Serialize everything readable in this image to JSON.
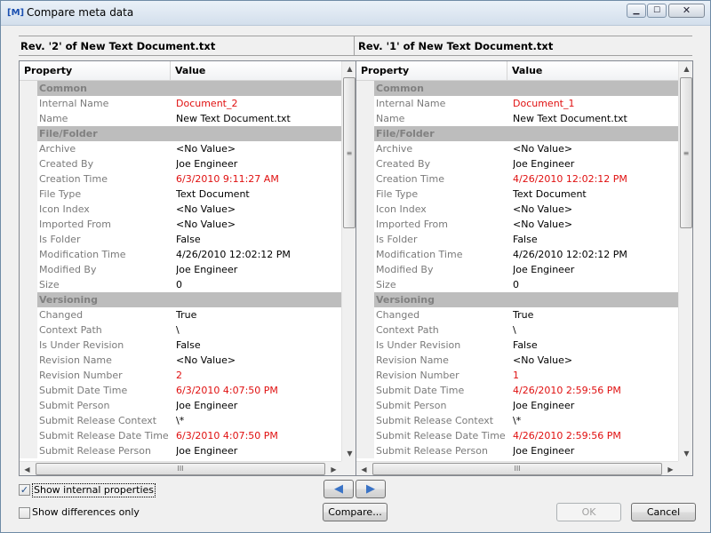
{
  "window": {
    "icon_label": "[M]",
    "title": "Compare meta data",
    "min_glyph": "▁",
    "max_glyph": "☐",
    "close_glyph": "✕"
  },
  "left": {
    "header": "Rev. '2' of New Text Document.txt",
    "columns": {
      "property": "Property",
      "value": "Value"
    },
    "rows": [
      {
        "type": "cat",
        "label": "Common"
      },
      {
        "type": "prop",
        "name": "Internal Name",
        "value": "Document_2",
        "diff": true
      },
      {
        "type": "prop",
        "name": "Name",
        "value": "New Text Document.txt",
        "diff": false
      },
      {
        "type": "cat",
        "label": "File/Folder"
      },
      {
        "type": "prop",
        "name": "Archive",
        "value": "<No Value>",
        "diff": false
      },
      {
        "type": "prop",
        "name": "Created By",
        "value": "Joe Engineer",
        "diff": false
      },
      {
        "type": "prop",
        "name": "Creation Time",
        "value": "6/3/2010 9:11:27 AM",
        "diff": true
      },
      {
        "type": "prop",
        "name": "File Type",
        "value": "Text Document",
        "diff": false
      },
      {
        "type": "prop",
        "name": "Icon Index",
        "value": "<No Value>",
        "diff": false
      },
      {
        "type": "prop",
        "name": "Imported From",
        "value": "<No Value>",
        "diff": false
      },
      {
        "type": "prop",
        "name": "Is Folder",
        "value": "False",
        "diff": false
      },
      {
        "type": "prop",
        "name": "Modification Time",
        "value": "4/26/2010 12:02:12 PM",
        "diff": false
      },
      {
        "type": "prop",
        "name": "Modified By",
        "value": "Joe Engineer",
        "diff": false
      },
      {
        "type": "prop",
        "name": "Size",
        "value": "0",
        "diff": false
      },
      {
        "type": "cat",
        "label": "Versioning"
      },
      {
        "type": "prop",
        "name": "Changed",
        "value": "True",
        "diff": false
      },
      {
        "type": "prop",
        "name": "Context Path",
        "value": "\\",
        "diff": false
      },
      {
        "type": "prop",
        "name": "Is Under Revision",
        "value": "False",
        "diff": false
      },
      {
        "type": "prop",
        "name": "Revision Name",
        "value": "<No Value>",
        "diff": false
      },
      {
        "type": "prop",
        "name": "Revision Number",
        "value": "2",
        "diff": true
      },
      {
        "type": "prop",
        "name": "Submit Date Time",
        "value": "6/3/2010 4:07:50 PM",
        "diff": true
      },
      {
        "type": "prop",
        "name": "Submit Person",
        "value": "Joe Engineer",
        "diff": false
      },
      {
        "type": "prop",
        "name": "Submit Release Context",
        "value": "\\*",
        "diff": false
      },
      {
        "type": "prop",
        "name": "Submit Release Date Time",
        "value": "6/3/2010 4:07:50 PM",
        "diff": true
      },
      {
        "type": "prop",
        "name": "Submit Release Person",
        "value": "Joe Engineer",
        "diff": false
      }
    ]
  },
  "right": {
    "header": "Rev. '1' of New Text Document.txt",
    "columns": {
      "property": "Property",
      "value": "Value"
    },
    "rows": [
      {
        "type": "cat",
        "label": "Common"
      },
      {
        "type": "prop",
        "name": "Internal Name",
        "value": "Document_1",
        "diff": true
      },
      {
        "type": "prop",
        "name": "Name",
        "value": "New Text Document.txt",
        "diff": false
      },
      {
        "type": "cat",
        "label": "File/Folder"
      },
      {
        "type": "prop",
        "name": "Archive",
        "value": "<No Value>",
        "diff": false
      },
      {
        "type": "prop",
        "name": "Created By",
        "value": "Joe Engineer",
        "diff": false
      },
      {
        "type": "prop",
        "name": "Creation Time",
        "value": "4/26/2010 12:02:12 PM",
        "diff": true
      },
      {
        "type": "prop",
        "name": "File Type",
        "value": "Text Document",
        "diff": false
      },
      {
        "type": "prop",
        "name": "Icon Index",
        "value": "<No Value>",
        "diff": false
      },
      {
        "type": "prop",
        "name": "Imported From",
        "value": "<No Value>",
        "diff": false
      },
      {
        "type": "prop",
        "name": "Is Folder",
        "value": "False",
        "diff": false
      },
      {
        "type": "prop",
        "name": "Modification Time",
        "value": "4/26/2010 12:02:12 PM",
        "diff": false
      },
      {
        "type": "prop",
        "name": "Modified By",
        "value": "Joe Engineer",
        "diff": false
      },
      {
        "type": "prop",
        "name": "Size",
        "value": "0",
        "diff": false
      },
      {
        "type": "cat",
        "label": "Versioning"
      },
      {
        "type": "prop",
        "name": "Changed",
        "value": "True",
        "diff": false
      },
      {
        "type": "prop",
        "name": "Context Path",
        "value": "\\",
        "diff": false
      },
      {
        "type": "prop",
        "name": "Is Under Revision",
        "value": "False",
        "diff": false
      },
      {
        "type": "prop",
        "name": "Revision Name",
        "value": "<No Value>",
        "diff": false
      },
      {
        "type": "prop",
        "name": "Revision Number",
        "value": "1",
        "diff": true
      },
      {
        "type": "prop",
        "name": "Submit Date Time",
        "value": "4/26/2010 2:59:56 PM",
        "diff": true
      },
      {
        "type": "prop",
        "name": "Submit Person",
        "value": "Joe Engineer",
        "diff": false
      },
      {
        "type": "prop",
        "name": "Submit Release Context",
        "value": "\\*",
        "diff": false
      },
      {
        "type": "prop",
        "name": "Submit Release Date Time",
        "value": "4/26/2010 2:59:56 PM",
        "diff": true
      },
      {
        "type": "prop",
        "name": "Submit Release Person",
        "value": "Joe Engineer",
        "diff": false
      }
    ]
  },
  "scroll": {
    "up": "▲",
    "down": "▼",
    "left": "◀",
    "right": "▶",
    "grip_v": "≡",
    "grip_h": "III"
  },
  "options": {
    "show_internal": {
      "label": "Show internal properties",
      "checked": true,
      "mark": "✓"
    },
    "show_diff_only": {
      "label": "Show differences only",
      "checked": false,
      "mark": ""
    }
  },
  "buttons": {
    "prev": "◀",
    "next": "▶",
    "compare": "Compare...",
    "ok": "OK",
    "cancel": "Cancel"
  },
  "colors": {
    "diff": "#e01010",
    "category_bg": "#bdbdbd",
    "nav_arrow": "#3a73c6"
  }
}
